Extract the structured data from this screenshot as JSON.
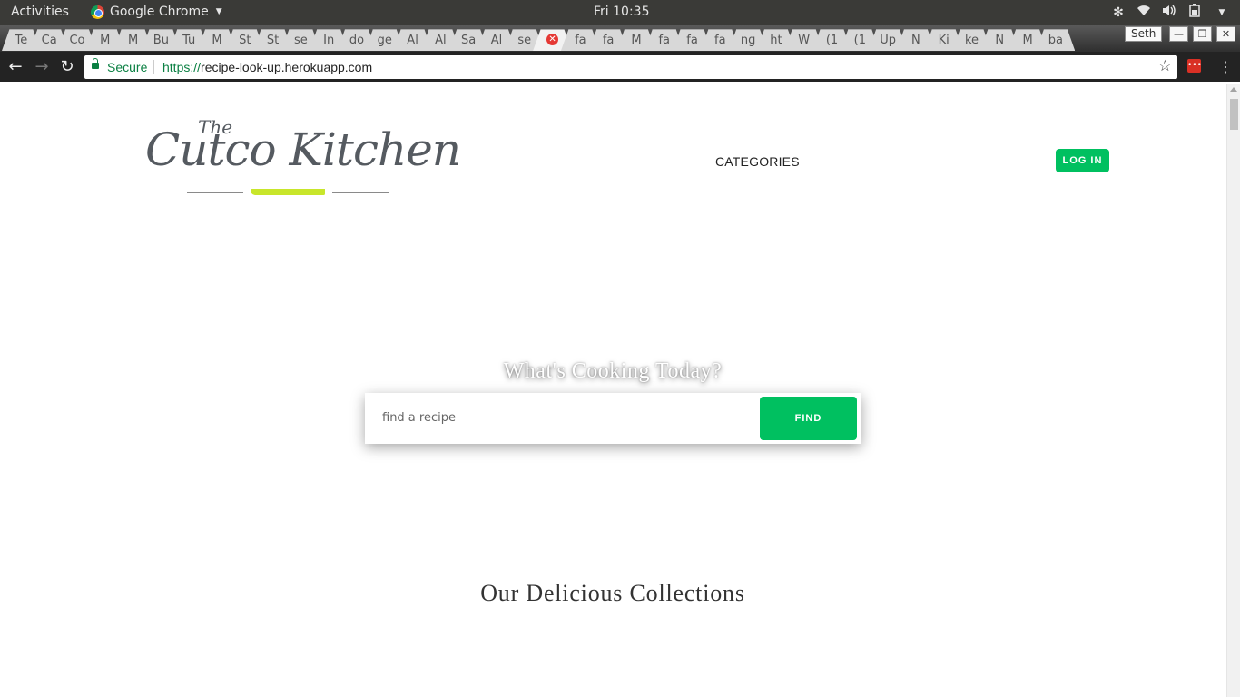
{
  "system_bar": {
    "activities": "Activities",
    "app_name": "Google Chrome",
    "clock": "Fri 10:35",
    "icons": [
      "settings-icon",
      "wifi-icon",
      "volume-icon",
      "battery-icon",
      "chevron-down-icon"
    ]
  },
  "browser": {
    "tabs": [
      {
        "label": "Te"
      },
      {
        "label": "Ca"
      },
      {
        "label": "Co"
      },
      {
        "label": "M"
      },
      {
        "label": "M"
      },
      {
        "label": "Bu"
      },
      {
        "label": "Tu"
      },
      {
        "label": "M"
      },
      {
        "label": "St"
      },
      {
        "label": "St"
      },
      {
        "label": "se"
      },
      {
        "label": "In"
      },
      {
        "label": "do"
      },
      {
        "label": "ge"
      },
      {
        "label": "Al"
      },
      {
        "label": "Al"
      },
      {
        "label": "Sa"
      },
      {
        "label": "Al"
      },
      {
        "label": "se"
      },
      {
        "label": "",
        "state": "error",
        "active": true
      },
      {
        "label": "fa"
      },
      {
        "label": "fa"
      },
      {
        "label": "M"
      },
      {
        "label": "fa"
      },
      {
        "label": "fa"
      },
      {
        "label": "fa"
      },
      {
        "label": "ng"
      },
      {
        "label": "ht"
      },
      {
        "label": "W"
      },
      {
        "label": "(1"
      },
      {
        "label": "(1"
      },
      {
        "label": "Up"
      },
      {
        "label": "N"
      },
      {
        "label": "Ki"
      },
      {
        "label": "ke"
      },
      {
        "label": "N"
      },
      {
        "label": "M"
      },
      {
        "label": "ba"
      }
    ],
    "profile_name": "Seth",
    "address": {
      "secure_label": "Secure",
      "scheme": "https://",
      "host": "recipe-look-up.herokuapp.com"
    }
  },
  "site": {
    "logo": {
      "the": "The",
      "name": "Cutco Kitchen",
      "accent_color": "#c8e62b"
    },
    "nav": {
      "categories": "CATEGORIES",
      "login": "LOG IN"
    },
    "hero": {
      "title": "What's Cooking Today?",
      "search_placeholder": "find a recipe",
      "search_value": "",
      "find_button": "FIND"
    },
    "collections_title": "Our Delicious Collections",
    "accent_color": "#00c060"
  }
}
